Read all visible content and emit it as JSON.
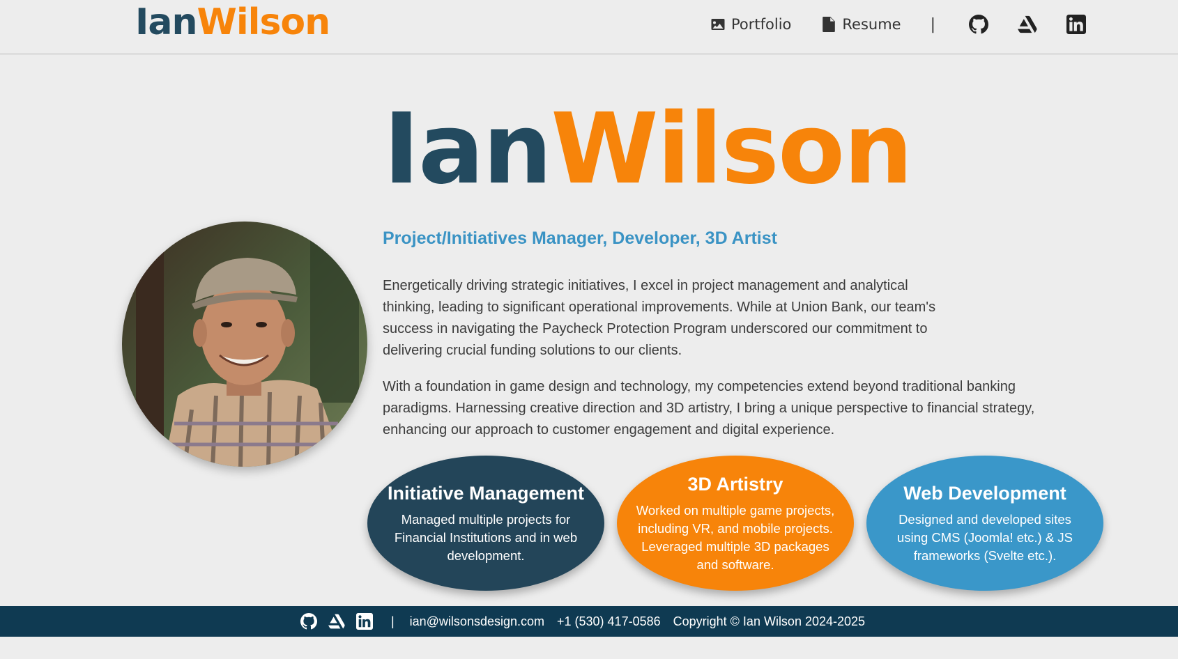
{
  "header": {
    "logo_first": "Ian",
    "logo_last": "Wilson",
    "nav": {
      "portfolio_label": "Portfolio",
      "resume_label": "Resume",
      "separator": "|",
      "icons": [
        "github-icon",
        "artstation-icon",
        "linkedin-icon"
      ]
    }
  },
  "hero": {
    "name_first": "Ian",
    "name_last": "Wilson",
    "tagline": "Project/Initiatives Manager, Developer, 3D Artist",
    "paragraph1": "Energetically driving strategic initiatives, I excel in project management and analytical thinking, leading to significant operational improvements. While at Union Bank, our team's success in navigating the Paycheck Protection Program underscored our commitment to delivering crucial funding solutions to our clients.",
    "paragraph2": "With a foundation in game design and technology, my competencies extend beyond traditional banking paradigms. Harnessing creative direction and 3D artistry, I bring a unique perspective to financial strategy, enhancing our approach to customer engagement and digital experience."
  },
  "skills": [
    {
      "title": "Initiative Management",
      "desc": "Managed multiple projects for Financial Institutions and in web development."
    },
    {
      "title": "3D Artistry",
      "desc": "Worked on multiple game projects, including VR, and mobile projects. Leveraged multiple 3D packages and software."
    },
    {
      "title": "Web Development",
      "desc": "Designed and developed sites using CMS (Joomla! etc.) & JS frameworks (Svelte etc.)."
    }
  ],
  "footer": {
    "separator": "|",
    "email": "ian@wilsonsdesign.com",
    "phone": "+1 (530) 417-0586",
    "copyright": "Copyright © Ian Wilson 2024-2025"
  },
  "colors": {
    "navy": "#234a5f",
    "orange": "#f7840a",
    "blue": "#3a97c9",
    "footer_bg": "#0f3a52",
    "page_bg": "#ededed"
  }
}
